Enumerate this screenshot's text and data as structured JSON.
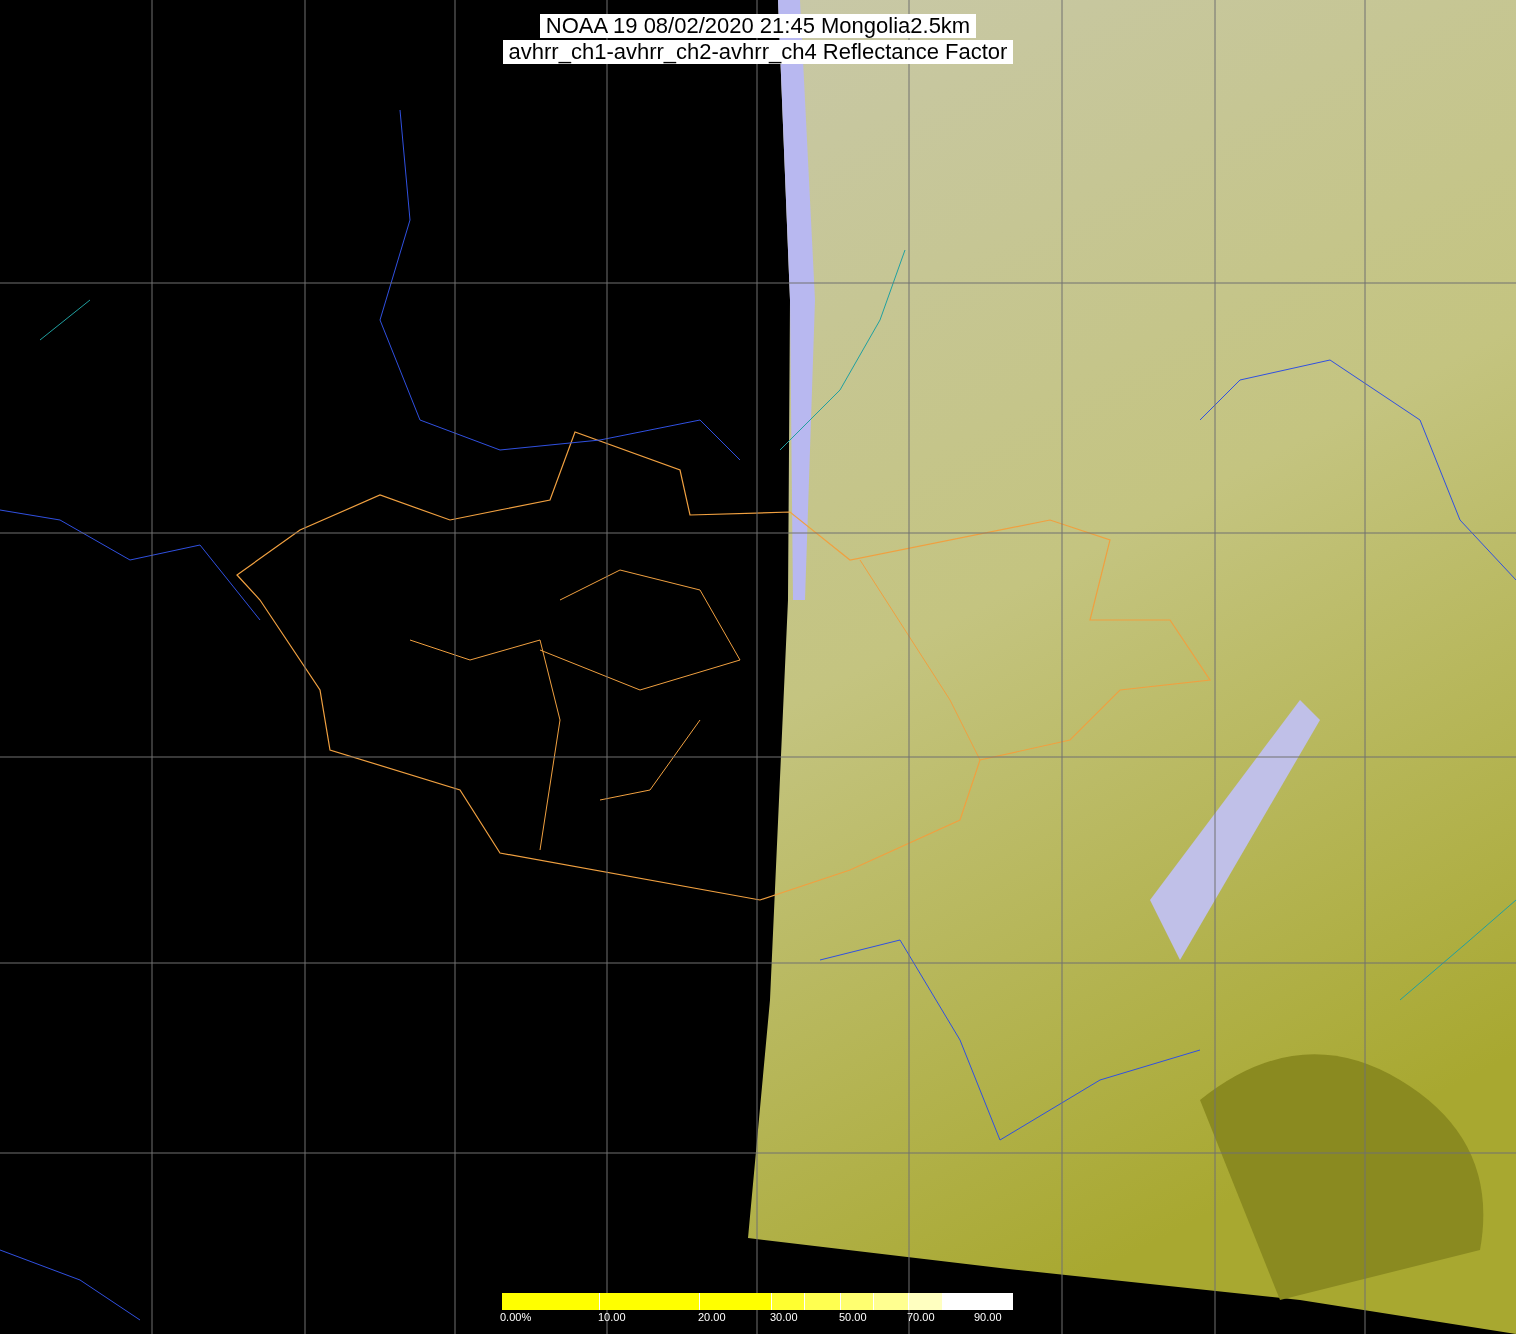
{
  "title_lines": [
    "NOAA 19 08/02/2020 21:45 Mongolia2.5km",
    "avhrr_ch1-avhrr_ch2-avhrr_ch4 Reflectance Factor"
  ],
  "colorbar": {
    "segments": [
      {
        "color": "#ffff00",
        "label": "0.00%"
      },
      {
        "color": "#ffff00",
        "label": "10.00"
      },
      {
        "color": "#ffff00",
        "label": "20.00"
      },
      {
        "color": "#ffff30",
        "label": "30.00"
      },
      {
        "color": "#ffff50"
      },
      {
        "color": "#ffff70",
        "label": "50.00"
      },
      {
        "color": "#ffff90"
      },
      {
        "color": "#ffffc0",
        "label": "70.00"
      },
      {
        "color": "#ffffff"
      },
      {
        "color": "#ffffff",
        "label": "90.00"
      },
      {
        "color": "#ffffff"
      }
    ]
  }
}
